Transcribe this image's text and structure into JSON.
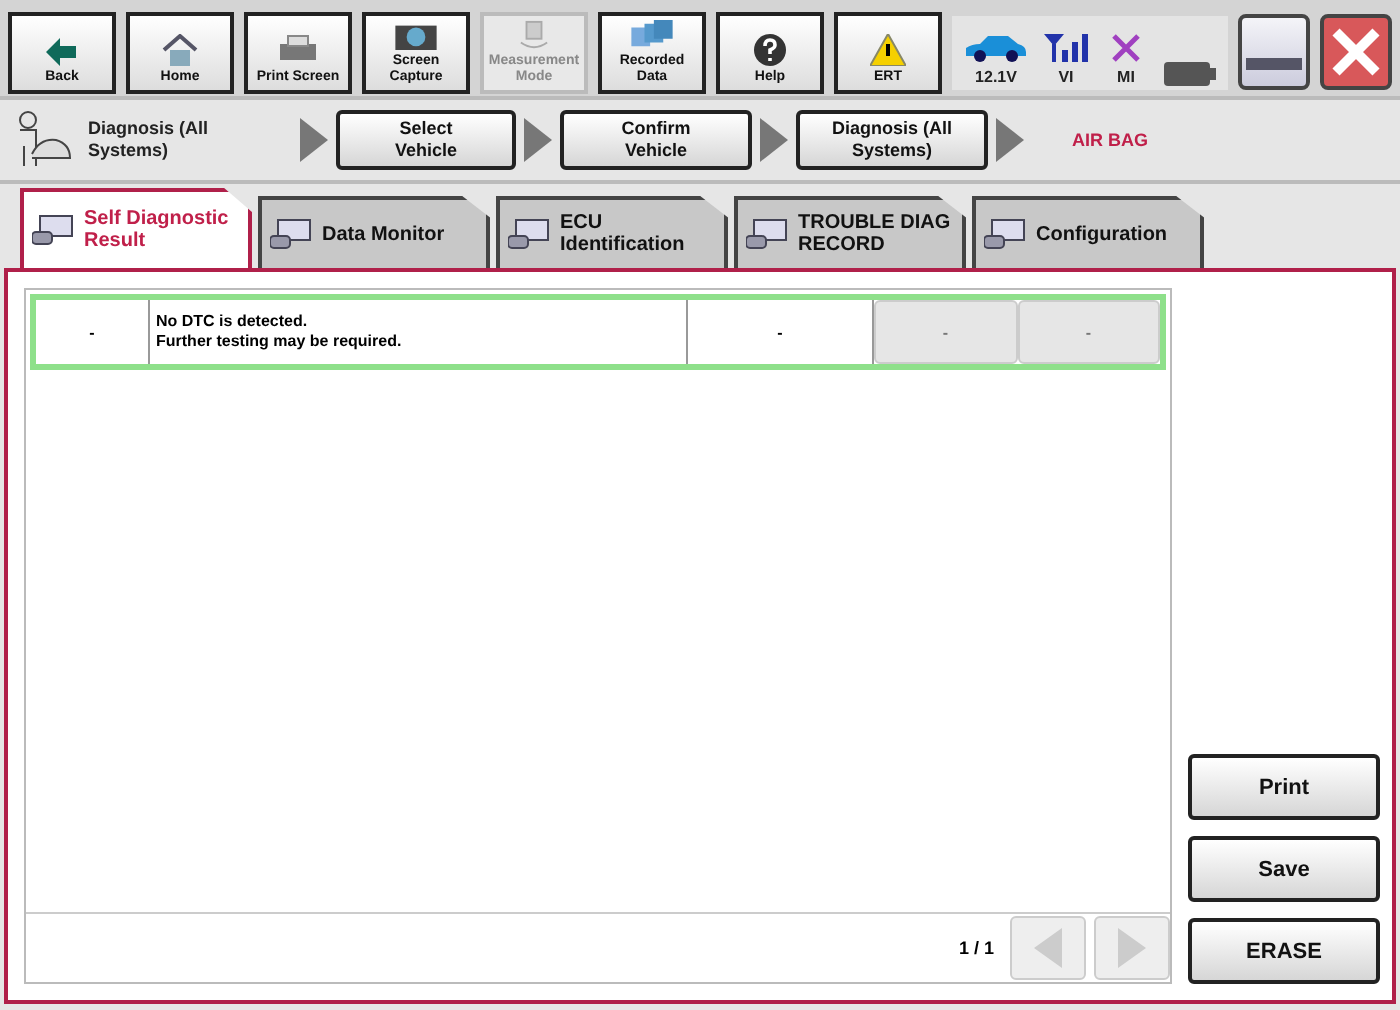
{
  "toolbar": {
    "buttons": [
      {
        "kind": "back",
        "label": "Back",
        "disabled": false
      },
      {
        "kind": "home",
        "label": "Home",
        "disabled": false
      },
      {
        "kind": "print",
        "label": "Print Screen",
        "disabled": false
      },
      {
        "kind": "camera",
        "label": "Screen Capture",
        "disabled": false
      },
      {
        "kind": "measure",
        "label": "Measurement Mode",
        "disabled": true
      },
      {
        "kind": "recorded",
        "label": "Recorded Data",
        "disabled": false
      },
      {
        "kind": "help",
        "label": "Help",
        "disabled": false
      },
      {
        "kind": "ert",
        "label": "ERT",
        "disabled": false
      }
    ],
    "status": [
      {
        "kind": "car",
        "label": "12.1V"
      },
      {
        "kind": "signal",
        "label": "VI"
      },
      {
        "kind": "cross",
        "label": "MI"
      },
      {
        "kind": "battery"
      }
    ]
  },
  "breadcrumb": {
    "items": [
      {
        "kind": "root",
        "label": "Diagnosis (All Systems)"
      },
      {
        "kind": "button",
        "label": "Select Vehicle"
      },
      {
        "kind": "button",
        "label": "Confirm Vehicle"
      },
      {
        "kind": "button",
        "label": "Diagnosis (All Systems)"
      },
      {
        "kind": "current",
        "label": "AIR BAG"
      }
    ]
  },
  "tabs": [
    {
      "label": "Self Diagnostic Result",
      "selected": true
    },
    {
      "label": "Data Monitor",
      "selected": false
    },
    {
      "label": "ECU Identification",
      "selected": false
    },
    {
      "label": "TROUBLE DIAG RECORD",
      "selected": false
    },
    {
      "label": "Configuration",
      "selected": false
    }
  ],
  "table": {
    "rows": [
      {
        "cells": [
          {
            "text": "-",
            "kind": "plain"
          },
          {
            "text": "No DTC is detected.\nFurther testing may be required.",
            "kind": "text"
          },
          {
            "text": "-",
            "kind": "plain"
          },
          {
            "text": "-",
            "kind": "button"
          },
          {
            "text": "-",
            "kind": "button"
          }
        ]
      }
    ]
  },
  "pager": {
    "label": "1 / 1",
    "prev_disabled": true,
    "next_disabled": true
  },
  "actions": [
    "Print",
    "Save",
    "ERASE"
  ]
}
